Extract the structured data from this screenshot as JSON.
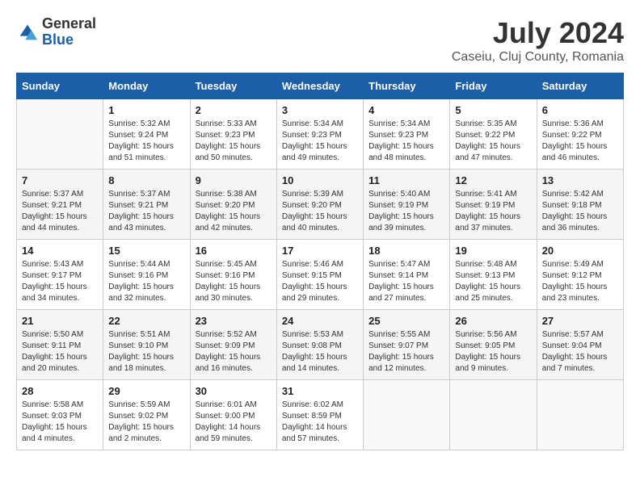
{
  "header": {
    "logo": {
      "general": "General",
      "blue": "Blue"
    },
    "title": "July 2024",
    "location": "Caseiu, Cluj County, Romania"
  },
  "weekdays": [
    "Sunday",
    "Monday",
    "Tuesday",
    "Wednesday",
    "Thursday",
    "Friday",
    "Saturday"
  ],
  "weeks": [
    [
      {
        "day": "",
        "sunrise": "",
        "sunset": "",
        "daylight": ""
      },
      {
        "day": "1",
        "sunrise": "Sunrise: 5:32 AM",
        "sunset": "Sunset: 9:24 PM",
        "daylight": "Daylight: 15 hours and 51 minutes."
      },
      {
        "day": "2",
        "sunrise": "Sunrise: 5:33 AM",
        "sunset": "Sunset: 9:23 PM",
        "daylight": "Daylight: 15 hours and 50 minutes."
      },
      {
        "day": "3",
        "sunrise": "Sunrise: 5:34 AM",
        "sunset": "Sunset: 9:23 PM",
        "daylight": "Daylight: 15 hours and 49 minutes."
      },
      {
        "day": "4",
        "sunrise": "Sunrise: 5:34 AM",
        "sunset": "Sunset: 9:23 PM",
        "daylight": "Daylight: 15 hours and 48 minutes."
      },
      {
        "day": "5",
        "sunrise": "Sunrise: 5:35 AM",
        "sunset": "Sunset: 9:22 PM",
        "daylight": "Daylight: 15 hours and 47 minutes."
      },
      {
        "day": "6",
        "sunrise": "Sunrise: 5:36 AM",
        "sunset": "Sunset: 9:22 PM",
        "daylight": "Daylight: 15 hours and 46 minutes."
      }
    ],
    [
      {
        "day": "7",
        "sunrise": "Sunrise: 5:37 AM",
        "sunset": "Sunset: 9:21 PM",
        "daylight": "Daylight: 15 hours and 44 minutes."
      },
      {
        "day": "8",
        "sunrise": "Sunrise: 5:37 AM",
        "sunset": "Sunset: 9:21 PM",
        "daylight": "Daylight: 15 hours and 43 minutes."
      },
      {
        "day": "9",
        "sunrise": "Sunrise: 5:38 AM",
        "sunset": "Sunset: 9:20 PM",
        "daylight": "Daylight: 15 hours and 42 minutes."
      },
      {
        "day": "10",
        "sunrise": "Sunrise: 5:39 AM",
        "sunset": "Sunset: 9:20 PM",
        "daylight": "Daylight: 15 hours and 40 minutes."
      },
      {
        "day": "11",
        "sunrise": "Sunrise: 5:40 AM",
        "sunset": "Sunset: 9:19 PM",
        "daylight": "Daylight: 15 hours and 39 minutes."
      },
      {
        "day": "12",
        "sunrise": "Sunrise: 5:41 AM",
        "sunset": "Sunset: 9:19 PM",
        "daylight": "Daylight: 15 hours and 37 minutes."
      },
      {
        "day": "13",
        "sunrise": "Sunrise: 5:42 AM",
        "sunset": "Sunset: 9:18 PM",
        "daylight": "Daylight: 15 hours and 36 minutes."
      }
    ],
    [
      {
        "day": "14",
        "sunrise": "Sunrise: 5:43 AM",
        "sunset": "Sunset: 9:17 PM",
        "daylight": "Daylight: 15 hours and 34 minutes."
      },
      {
        "day": "15",
        "sunrise": "Sunrise: 5:44 AM",
        "sunset": "Sunset: 9:16 PM",
        "daylight": "Daylight: 15 hours and 32 minutes."
      },
      {
        "day": "16",
        "sunrise": "Sunrise: 5:45 AM",
        "sunset": "Sunset: 9:16 PM",
        "daylight": "Daylight: 15 hours and 30 minutes."
      },
      {
        "day": "17",
        "sunrise": "Sunrise: 5:46 AM",
        "sunset": "Sunset: 9:15 PM",
        "daylight": "Daylight: 15 hours and 29 minutes."
      },
      {
        "day": "18",
        "sunrise": "Sunrise: 5:47 AM",
        "sunset": "Sunset: 9:14 PM",
        "daylight": "Daylight: 15 hours and 27 minutes."
      },
      {
        "day": "19",
        "sunrise": "Sunrise: 5:48 AM",
        "sunset": "Sunset: 9:13 PM",
        "daylight": "Daylight: 15 hours and 25 minutes."
      },
      {
        "day": "20",
        "sunrise": "Sunrise: 5:49 AM",
        "sunset": "Sunset: 9:12 PM",
        "daylight": "Daylight: 15 hours and 23 minutes."
      }
    ],
    [
      {
        "day": "21",
        "sunrise": "Sunrise: 5:50 AM",
        "sunset": "Sunset: 9:11 PM",
        "daylight": "Daylight: 15 hours and 20 minutes."
      },
      {
        "day": "22",
        "sunrise": "Sunrise: 5:51 AM",
        "sunset": "Sunset: 9:10 PM",
        "daylight": "Daylight: 15 hours and 18 minutes."
      },
      {
        "day": "23",
        "sunrise": "Sunrise: 5:52 AM",
        "sunset": "Sunset: 9:09 PM",
        "daylight": "Daylight: 15 hours and 16 minutes."
      },
      {
        "day": "24",
        "sunrise": "Sunrise: 5:53 AM",
        "sunset": "Sunset: 9:08 PM",
        "daylight": "Daylight: 15 hours and 14 minutes."
      },
      {
        "day": "25",
        "sunrise": "Sunrise: 5:55 AM",
        "sunset": "Sunset: 9:07 PM",
        "daylight": "Daylight: 15 hours and 12 minutes."
      },
      {
        "day": "26",
        "sunrise": "Sunrise: 5:56 AM",
        "sunset": "Sunset: 9:05 PM",
        "daylight": "Daylight: 15 hours and 9 minutes."
      },
      {
        "day": "27",
        "sunrise": "Sunrise: 5:57 AM",
        "sunset": "Sunset: 9:04 PM",
        "daylight": "Daylight: 15 hours and 7 minutes."
      }
    ],
    [
      {
        "day": "28",
        "sunrise": "Sunrise: 5:58 AM",
        "sunset": "Sunset: 9:03 PM",
        "daylight": "Daylight: 15 hours and 4 minutes."
      },
      {
        "day": "29",
        "sunrise": "Sunrise: 5:59 AM",
        "sunset": "Sunset: 9:02 PM",
        "daylight": "Daylight: 15 hours and 2 minutes."
      },
      {
        "day": "30",
        "sunrise": "Sunrise: 6:01 AM",
        "sunset": "Sunset: 9:00 PM",
        "daylight": "Daylight: 14 hours and 59 minutes."
      },
      {
        "day": "31",
        "sunrise": "Sunrise: 6:02 AM",
        "sunset": "Sunset: 8:59 PM",
        "daylight": "Daylight: 14 hours and 57 minutes."
      },
      {
        "day": "",
        "sunrise": "",
        "sunset": "",
        "daylight": ""
      },
      {
        "day": "",
        "sunrise": "",
        "sunset": "",
        "daylight": ""
      },
      {
        "day": "",
        "sunrise": "",
        "sunset": "",
        "daylight": ""
      }
    ]
  ]
}
